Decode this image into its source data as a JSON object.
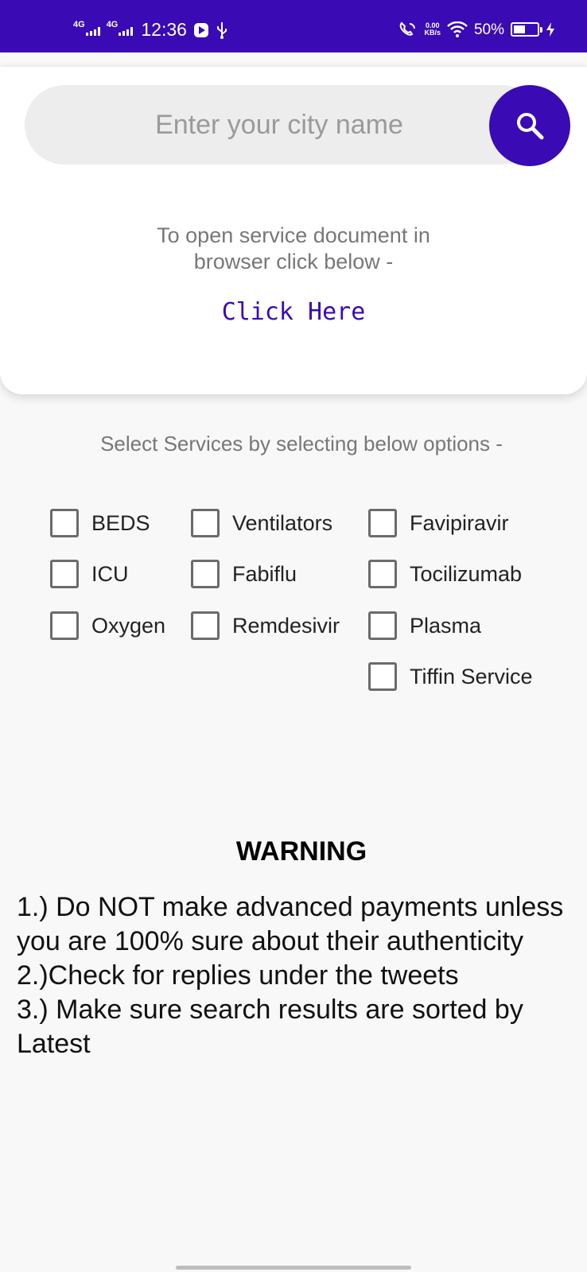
{
  "status_bar": {
    "sim1": "4G",
    "sim2": "4G",
    "time": "12:36",
    "speed_value": "0.00",
    "speed_unit": "KB/s",
    "battery": "50%",
    "background_color": "#3a0ab4"
  },
  "search": {
    "placeholder": "Enter your city name",
    "button_icon": "search-icon"
  },
  "info": {
    "line1": "To open service document in",
    "line2": "browser click below -",
    "link_label": "Click Here"
  },
  "services": {
    "prompt": "Select Services by selecting below options -",
    "options": [
      {
        "label": "BEDS",
        "checked": false
      },
      {
        "label": "Ventilators",
        "checked": false
      },
      {
        "label": "Favipiravir",
        "checked": false
      },
      {
        "label": "ICU",
        "checked": false
      },
      {
        "label": "Fabiflu",
        "checked": false
      },
      {
        "label": "Tocilizumab",
        "checked": false
      },
      {
        "label": "Oxygen",
        "checked": false
      },
      {
        "label": "Remdesivir",
        "checked": false
      },
      {
        "label": "Plasma",
        "checked": false
      },
      {
        "label": "Tiffin Service",
        "checked": false
      }
    ]
  },
  "warning": {
    "title": "WARNING",
    "lines": [
      "1.) Do NOT make advanced payments unless you are 100% sure about their authenticity",
      "2.)Check for replies under the tweets",
      "3.) Make sure search results are sorted by Latest"
    ]
  },
  "colors": {
    "accent": "#3a0ab4",
    "background": "#f8f8f8"
  }
}
